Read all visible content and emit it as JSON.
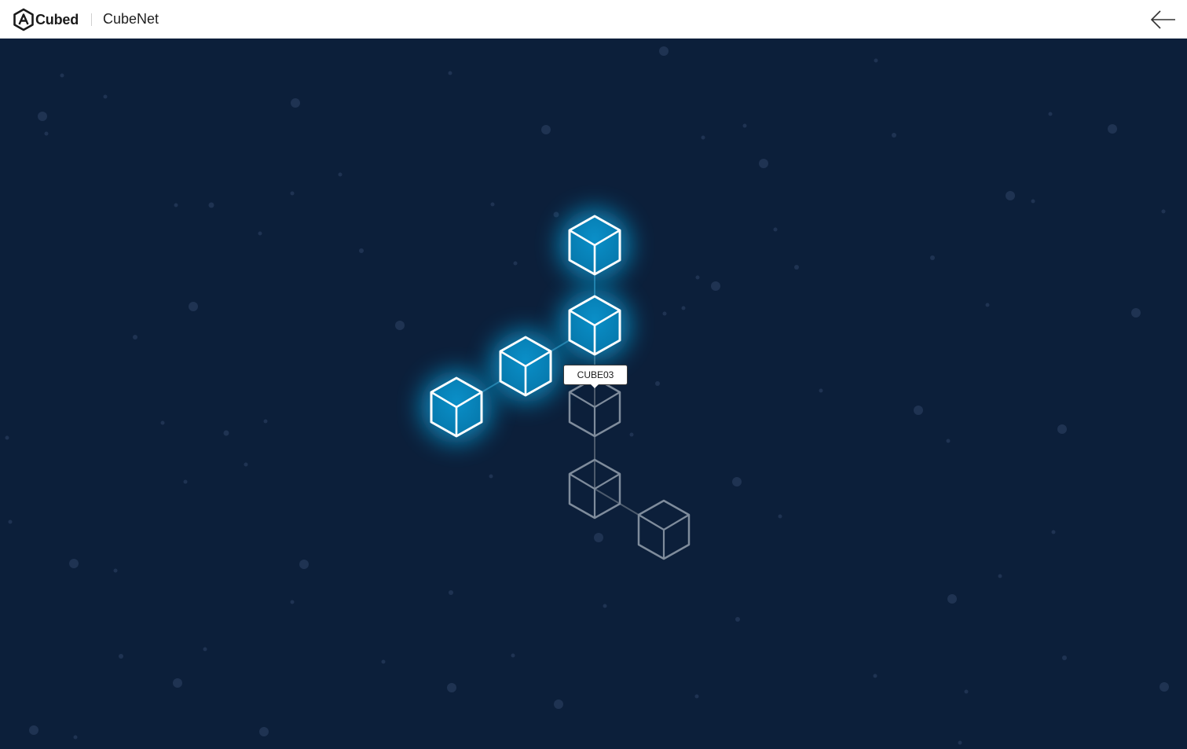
{
  "header": {
    "brand_name": "Cubed",
    "app_title": "CubeNet",
    "logo_icon": "hexagon-a-logo-icon",
    "back_icon": "arrow-left-icon"
  },
  "network": {
    "active_color": "#0a9fd8",
    "inactive_color": "#7f8c9c",
    "edge_color": "#4d5b6d",
    "cubes": [
      {
        "id": "cube-1",
        "state": "active"
      },
      {
        "id": "cube-2",
        "state": "active"
      },
      {
        "id": "cube-3",
        "state": "active"
      },
      {
        "id": "cube-4",
        "state": "active"
      },
      {
        "id": "cube-5",
        "state": "inactive"
      },
      {
        "id": "cube-6",
        "state": "inactive"
      },
      {
        "id": "cube-7",
        "state": "inactive"
      }
    ],
    "tooltip": {
      "label": "CUBE03"
    }
  }
}
